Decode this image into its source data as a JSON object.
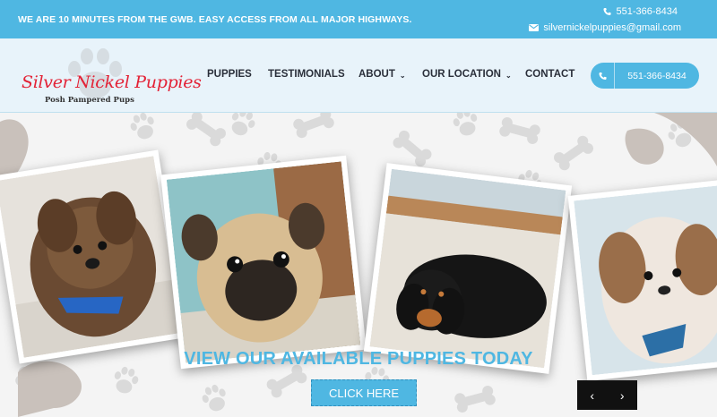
{
  "topbar": {
    "promo": "WE ARE 10 MINUTES FROM THE GWB. EASY ACCESS FROM ALL MAJOR HIGHWAYS.",
    "phone": "551-366-8434",
    "email": "silvernickelpuppies@gmail.com"
  },
  "logo": {
    "brand": "Silver Nickel Puppies",
    "tagline": "Posh Pampered Pups"
  },
  "nav": {
    "items": [
      {
        "label": "PUPPIES",
        "dropdown": false
      },
      {
        "label": "TESTIMONIALS",
        "dropdown": false
      },
      {
        "label": "ABOUT",
        "dropdown": true
      },
      {
        "label": "OUR LOCATION",
        "dropdown": true
      },
      {
        "label": "CONTACT",
        "dropdown": false
      }
    ],
    "dropdown_glyph": "⌄"
  },
  "call_button": {
    "number": "551-366-8434"
  },
  "hero": {
    "headline": "VIEW OUR AVAILABLE PUPPIES TODAY",
    "cta_label": "CLICK HERE",
    "prev_glyph": "‹",
    "next_glyph": "›"
  },
  "colors": {
    "accent": "#4fb7e2",
    "brand_red": "#e32236",
    "nav_text": "#2a2f3a"
  },
  "icons": [
    "phone-icon",
    "envelope-icon",
    "paw-icon",
    "chevron-down-icon",
    "chevron-left-icon",
    "chevron-right-icon"
  ]
}
